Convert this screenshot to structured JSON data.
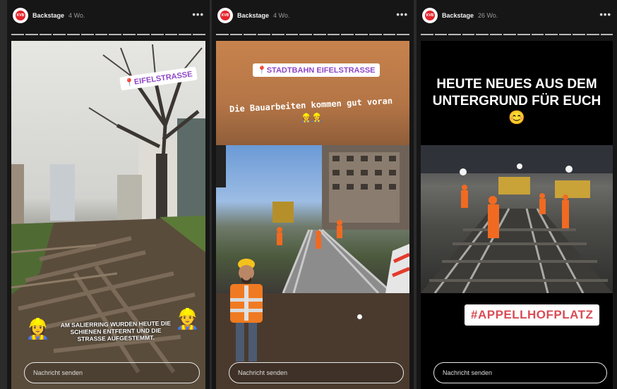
{
  "stories": [
    {
      "account": "Backstage",
      "time": "4 Wo.",
      "more": "•••",
      "location_tag": "EIFELSTRASSE",
      "caption": "AM SALIERRING WURDEN HEUTE DIE SCHIENEN ENTFERNT UND DIE STRASSE AUFGESTEMMT.",
      "reply_placeholder": "Nachricht senden"
    },
    {
      "account": "Backstage",
      "time": "4 Wo.",
      "more": "•••",
      "location_tag": "STADTBAHN EIFELSTRASSE",
      "caption": "Die Bauarbeiten kommen gut voran 👷👷",
      "reply_placeholder": "Nachricht senden"
    },
    {
      "account": "Backstage",
      "time": "26 Wo.",
      "more": "•••",
      "heading": "HEUTE NEUES AUS DEM UNTERGRUND FÜR EUCH 😊",
      "hashtag": "#APPELLHOFPLATZ",
      "reply_placeholder": "Nachricht senden"
    }
  ],
  "avatar_label": "KVB",
  "colors": {
    "brand_red": "#e4262d",
    "tag_purple": "#8f46c6",
    "hashtag_red": "#d94c55"
  }
}
